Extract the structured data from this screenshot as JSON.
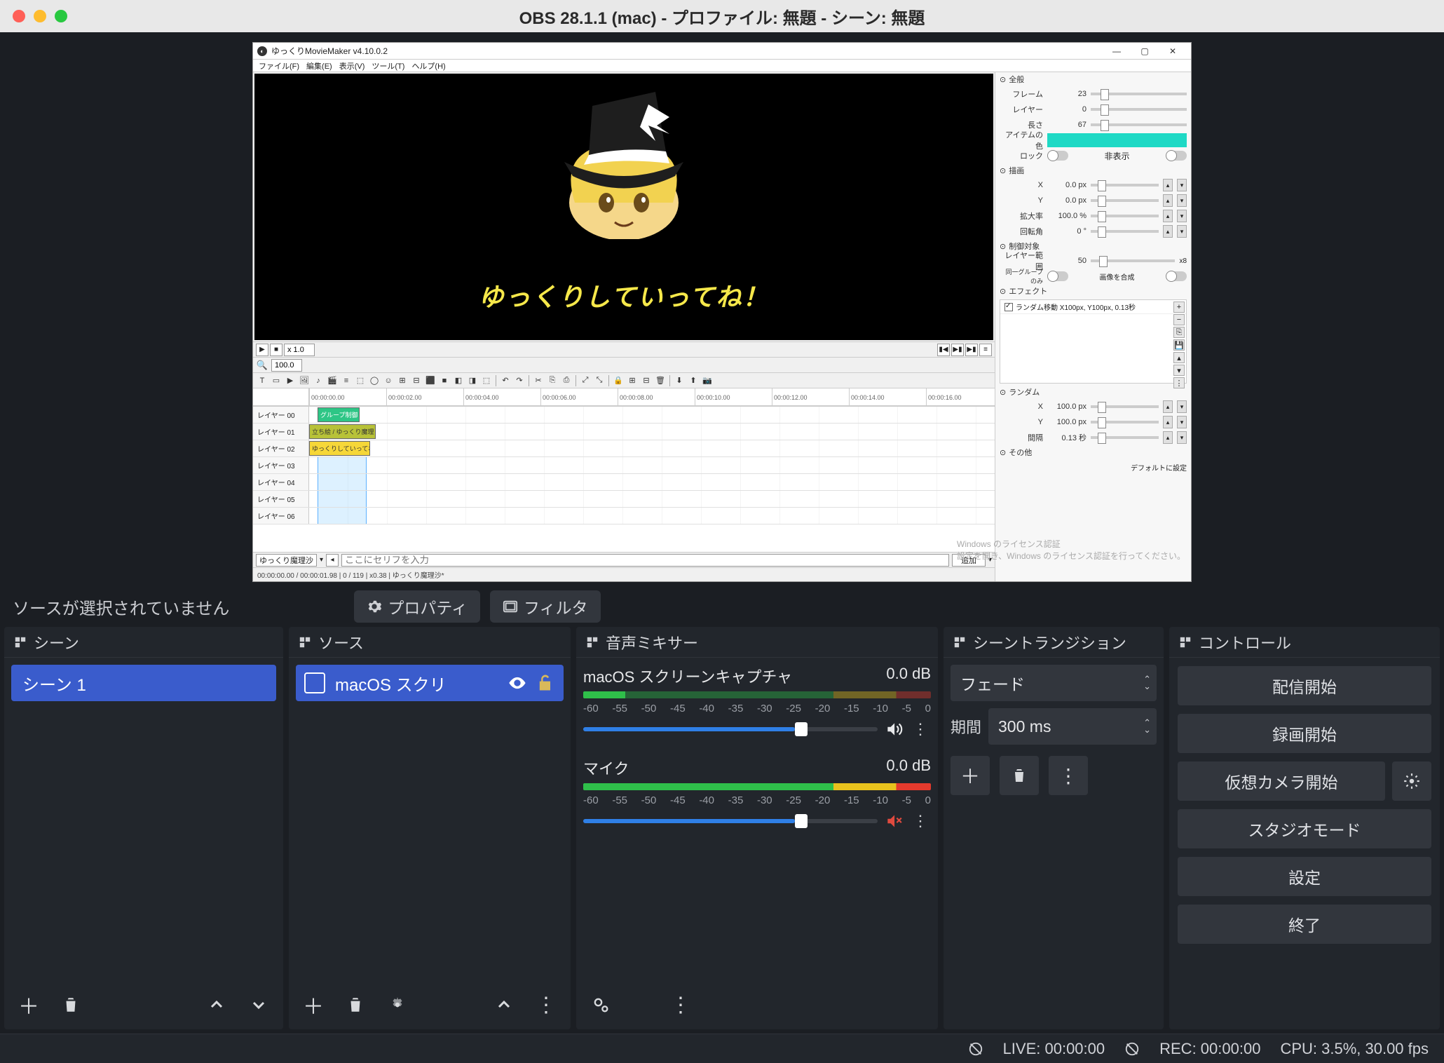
{
  "title": "OBS 28.1.1 (mac) - プロファイル: 無題 - シーン: 無題",
  "no_source_selected": "ソースが選択されていません",
  "toolbar": {
    "properties": "プロパティ",
    "filters": "フィルタ"
  },
  "ymm": {
    "title": "ゆっくりMovieMaker v4.10.0.2",
    "menu": [
      "ファイル(F)",
      "編集(E)",
      "表示(V)",
      "ツール(T)",
      "ヘルプ(H)"
    ],
    "speed": "x 1.0",
    "zoom": "100.0",
    "yukkuri_text": "ゆっくりしていってね！",
    "timeline_marks": [
      "00:00:00.00",
      "00:00:02.00",
      "00:00:04.00",
      "00:00:06.00",
      "00:00:08.00",
      "00:00:10.00",
      "00:00:12.00",
      "00:00:14.00",
      "00:00:16.00"
    ],
    "layers": [
      "レイヤー 00",
      "レイヤー 01",
      "レイヤー 02",
      "レイヤー 03",
      "レイヤー 04",
      "レイヤー 05",
      "レイヤー 06"
    ],
    "clips": {
      "group": "グループ制御",
      "olive": "立ち絵 / ゆっくり魔理",
      "yellow": "ゆっくりしていってね！"
    },
    "bottom": {
      "character": "ゆっくり魔理沙",
      "placeholder": "ここにセリフを入力",
      "add_btn": "追加"
    },
    "status": "00:00:00.00 / 00:00:01.98  |  0 / 119  |  x0.38  |  ゆっくり魔理沙*",
    "watermark_title": "Windows のライセンス認証",
    "watermark_body": "設定を開き、Windows のライセンス認証を行ってください。",
    "props": {
      "zen": "全般",
      "frame": "フレーム",
      "frame_v": "23",
      "layer": "レイヤー",
      "layer_v": "0",
      "len": "長さ",
      "len_v": "67",
      "itemcolor": "アイテムの色",
      "lock": "ロック",
      "hide": "非表示",
      "draw": "描画",
      "x": "X",
      "x_v": "0.0 px",
      "y": "Y",
      "y_v": "0.0 px",
      "scale": "拡大率",
      "scale_v": "100.0 %",
      "rot": "回転角",
      "rot_v": "0 °",
      "ctrl": "制御対象",
      "layer_range": "レイヤー範囲",
      "layer_range_v": "50",
      "layer_range_mul": "x8",
      "same_group": "同一グループのみ",
      "compose": "画像を合成",
      "effect": "エフェクト",
      "effect_item": "ランダム移動 X100px, Y100px, 0.13秒",
      "random": "ランダム",
      "rx": "X",
      "rx_v": "100.0 px",
      "ry": "Y",
      "ry_v": "100.0 px",
      "interval": "間隔",
      "interval_v": "0.13 秒",
      "other": "その他",
      "reset": "デフォルトに設定"
    }
  },
  "docks": {
    "scenes": {
      "title": "シーン",
      "items": [
        "シーン 1"
      ]
    },
    "sources": {
      "title": "ソース",
      "items": [
        "macOS スクリ"
      ]
    },
    "mixer": {
      "title": "音声ミキサー",
      "channels": [
        {
          "name": "macOS スクリーンキャプチャ",
          "db": "0.0 dB",
          "muted": false
        },
        {
          "name": "マイク",
          "db": "0.0 dB",
          "muted": true
        }
      ],
      "ticks": [
        "-60",
        "-55",
        "-50",
        "-45",
        "-40",
        "-35",
        "-30",
        "-25",
        "-20",
        "-15",
        "-10",
        "-5",
        "0"
      ]
    },
    "transitions": {
      "title": "シーントランジション",
      "type": "フェード",
      "duration_label": "期間",
      "duration": "300 ms"
    },
    "controls": {
      "title": "コントロール",
      "buttons": {
        "stream": "配信開始",
        "record": "録画開始",
        "vcam": "仮想カメラ開始",
        "studio": "スタジオモード",
        "settings": "設定",
        "exit": "終了"
      }
    }
  },
  "status": {
    "live": "LIVE: 00:00:00",
    "rec": "REC: 00:00:00",
    "cpu": "CPU: 3.5%, 30.00 fps"
  }
}
